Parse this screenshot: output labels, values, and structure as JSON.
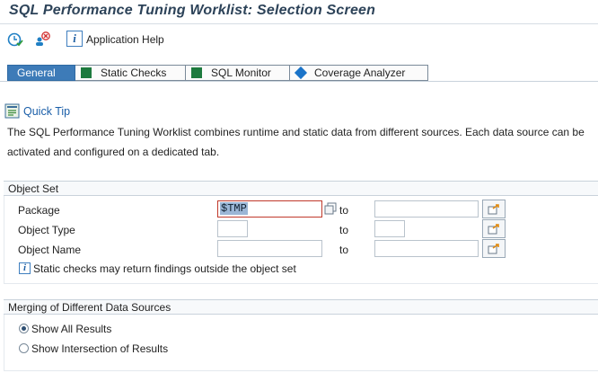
{
  "window": {
    "title": "SQL Performance Tuning Worklist: Selection Screen"
  },
  "toolbar": {
    "execute_icon": "clock-check-icon",
    "delete_icon": "person-delete-icon",
    "help_icon": "info-icon",
    "help_label": "Application Help"
  },
  "tabs": [
    {
      "label": "General",
      "active": true,
      "icon": ""
    },
    {
      "label": "Static Checks",
      "active": false,
      "icon": "green-square-icon"
    },
    {
      "label": "SQL Monitor",
      "active": false,
      "icon": "green-square-icon"
    },
    {
      "label": "Coverage Analyzer",
      "active": false,
      "icon": "blue-diamond-icon"
    }
  ],
  "quick_tip": {
    "label": "Quick Tip",
    "text": "The SQL Performance Tuning Worklist combines runtime and static data from different sources. Each data source can be activated and configured on a dedicated tab."
  },
  "object_set": {
    "title": "Object Set",
    "rows": [
      {
        "label": "Package",
        "from": "$TMP",
        "to_label": "to",
        "to": ""
      },
      {
        "label": "Object Type",
        "from": "",
        "to_label": "to",
        "to": ""
      },
      {
        "label": "Object Name",
        "from": "",
        "to_label": "to",
        "to": ""
      }
    ],
    "info": "Static checks may return findings outside the object set"
  },
  "merging": {
    "title": "Merging of Different Data Sources",
    "options": [
      {
        "label": "Show All Results",
        "selected": true
      },
      {
        "label": "Show Intersection of Results",
        "selected": false
      }
    ]
  },
  "colors": {
    "accent": "#3d7bb8",
    "title": "#2d4359",
    "link": "#1a5ea8",
    "tab_green": "#1d7a3e",
    "tab_blue": "#1a73c8"
  }
}
